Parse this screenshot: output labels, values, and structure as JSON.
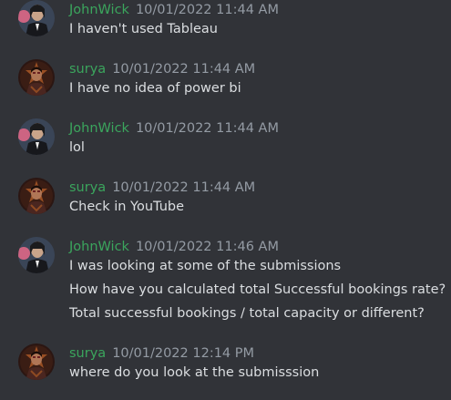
{
  "messages": [
    {
      "author": "JohnWick",
      "timestamp": "10/01/2022 11:44 AM",
      "lines": [
        "I haven't used Tableau"
      ],
      "avatar": "johnwick-avatar"
    },
    {
      "author": "surya",
      "timestamp": "10/01/2022 11:44 AM",
      "lines": [
        "I have no idea of power bi"
      ],
      "avatar": "surya-avatar"
    },
    {
      "author": "JohnWick",
      "timestamp": "10/01/2022 11:44 AM",
      "lines": [
        "lol"
      ],
      "avatar": "johnwick-avatar"
    },
    {
      "author": "surya",
      "timestamp": "10/01/2022 11:44 AM",
      "lines": [
        "Check in YouTube"
      ],
      "avatar": "surya-avatar"
    },
    {
      "author": "JohnWick",
      "timestamp": "10/01/2022 11:46 AM",
      "lines": [
        "I was looking at some of the submissions",
        "How have you calculated total Successful bookings rate?",
        "Total successful bookings / total capacity or different?"
      ],
      "avatar": "johnwick-avatar"
    },
    {
      "author": "surya",
      "timestamp": "10/01/2022 12:14 PM",
      "lines": [
        "where do you look at the submisssion"
      ],
      "avatar": "surya-avatar"
    }
  ],
  "colors": {
    "background": "#313338",
    "author": "#3ba55d",
    "timestamp": "#949ba4",
    "text": "#dbdee1"
  }
}
